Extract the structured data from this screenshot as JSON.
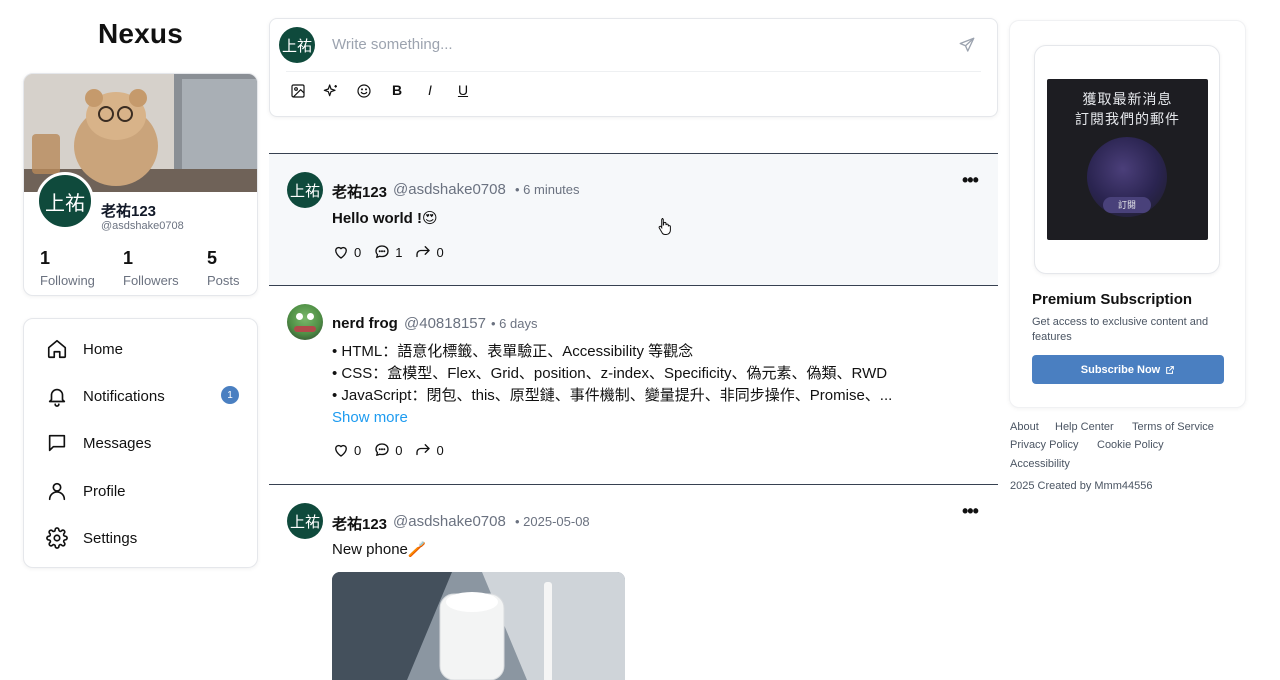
{
  "app": {
    "logo": "Nexus"
  },
  "profile": {
    "avatar_text": "上祐",
    "name": "老祐123",
    "handle": "@asdshake0708",
    "stats": [
      {
        "value": "1",
        "label": "Following"
      },
      {
        "value": "1",
        "label": "Followers"
      },
      {
        "value": "5",
        "label": "Posts"
      }
    ]
  },
  "nav": {
    "items": [
      {
        "label": "Home",
        "icon": "home-icon"
      },
      {
        "label": "Notifications",
        "icon": "bell-icon",
        "badge": "1"
      },
      {
        "label": "Messages",
        "icon": "message-icon"
      },
      {
        "label": "Profile",
        "icon": "user-icon"
      },
      {
        "label": "Settings",
        "icon": "gear-icon"
      }
    ]
  },
  "composer": {
    "avatar_text": "上祐",
    "placeholder": "Write something...",
    "tools": [
      "image-icon",
      "sparkle-icon",
      "emoji-icon",
      "B",
      "I",
      "U"
    ]
  },
  "posts": [
    {
      "avatar_text": "上祐",
      "author": "老祐123",
      "handle": "@asdshake0708",
      "time": "• 6 minutes",
      "body": "Hello world !😍",
      "likes": "0",
      "comments": "1",
      "shares": "0"
    },
    {
      "avatar": "frog-avatar",
      "author": "nerd frog",
      "handle": "@40818157",
      "time": "• 6 days",
      "lines": [
        "• HTML：語意化標籤、表單驗正、Accessibility 等觀念",
        "• CSS：盒模型、Flex、Grid、position、z-index、Specificity、偽元素、偽類、RWD",
        "• JavaScript：閉包、this、原型鏈、事件機制、變量提升、非同步操作、Promise、..."
      ],
      "show_more": "Show more",
      "likes": "0",
      "comments": "0",
      "shares": "0"
    },
    {
      "avatar_text": "上祐",
      "author": "老祐123",
      "handle": "@asdshake0708",
      "time": "• 2025-05-08",
      "body": "New phone🪥"
    }
  ],
  "sidebar_right": {
    "ad": {
      "line1": "獲取最新消息",
      "line2": "訂閱我們的郵件",
      "button": "訂閱"
    },
    "premium_title": "Premium Subscription",
    "premium_desc": "Get access to exclusive content and features",
    "subscribe_label": "Subscribe Now",
    "footer_links": [
      "About",
      "Help Center",
      "Terms of Service",
      "Privacy Policy",
      "Cookie Policy",
      "Accessibility"
    ],
    "copyright": "2025 Created by Mmm44556"
  },
  "colors": {
    "accent": "#4a7fc1",
    "avatar_bg": "#0f4a3c",
    "link": "#1d9bf0"
  }
}
